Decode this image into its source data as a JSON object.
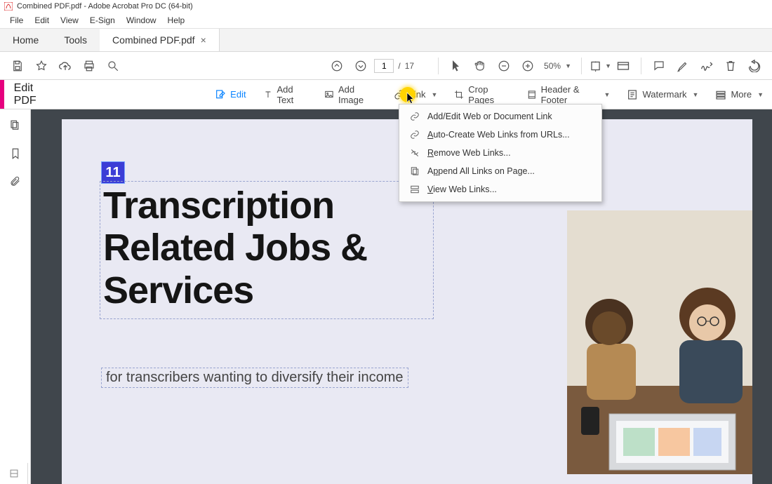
{
  "window": {
    "title": "Combined PDF.pdf - Adobe Acrobat Pro DC (64-bit)"
  },
  "menu": {
    "file": "File",
    "edit": "Edit",
    "view": "View",
    "esign": "E-Sign",
    "window": "Window",
    "help": "Help"
  },
  "tabs": {
    "home": "Home",
    "tools": "Tools",
    "doc": "Combined PDF.pdf",
    "close": "×"
  },
  "toolbar": {
    "current_page": "1",
    "page_sep": "/",
    "total_pages": "17",
    "zoom": "50%"
  },
  "editstrip": {
    "title": "Edit PDF",
    "edit": "Edit",
    "add_text": "Add Text",
    "add_image": "Add Image",
    "link": "Link",
    "crop": "Crop Pages",
    "header_footer": "Header & Footer",
    "watermark": "Watermark",
    "more": "More"
  },
  "link_menu": {
    "add_edit": "Add/Edit Web or Document Link",
    "auto_create": "Auto-Create Web Links from URLs...",
    "remove": "Remove Web Links...",
    "append": "Append All Links on Page...",
    "view": "View Web Links..."
  },
  "document": {
    "badge": "11",
    "heading": "Transcription Related Jobs & Services",
    "subtext": "for transcribers wanting to diversify their income"
  }
}
